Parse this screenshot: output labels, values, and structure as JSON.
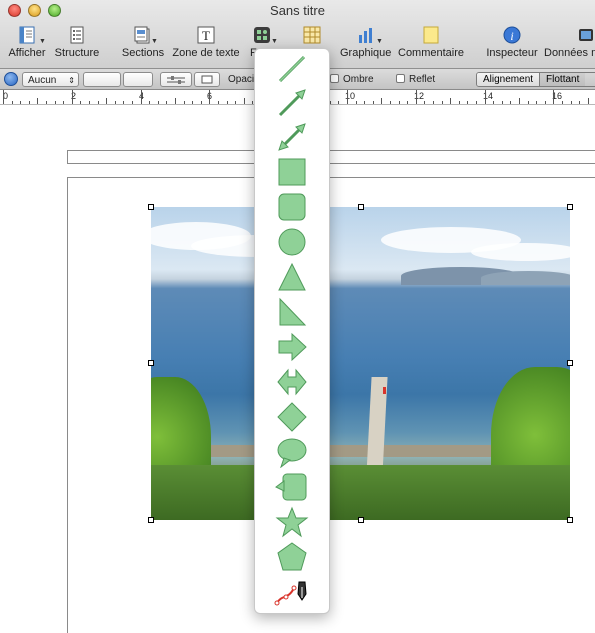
{
  "window": {
    "title": "Sans titre"
  },
  "toolbar": {
    "items": [
      {
        "label": "Afficher",
        "icon": "view-icon"
      },
      {
        "label": "Structure",
        "icon": "outline-icon"
      },
      {
        "label": "Sections",
        "icon": "sections-icon"
      },
      {
        "label": "Zone de texte",
        "icon": "textbox-icon"
      },
      {
        "label": "F",
        "icon": "shapes-icon"
      },
      {
        "label": "",
        "icon": "table-icon"
      },
      {
        "label": "Graphique",
        "icon": "chart-icon"
      },
      {
        "label": "Commentaire",
        "icon": "comment-icon"
      },
      {
        "label": "Inspecteur",
        "icon": "info-icon"
      },
      {
        "label": "Données m",
        "icon": "media-icon"
      }
    ]
  },
  "formatbar": {
    "wrap_value": "Aucun",
    "opacity_label": "Opaci",
    "shadow_label": "Ombre",
    "reflection_label": "Reflet",
    "alignment_label": "Alignement",
    "floating_label": "Flottant"
  },
  "ruler": {
    "numbers": [
      "0",
      "2",
      "4",
      "6",
      "10",
      "12",
      "14",
      "16"
    ]
  },
  "shape_menu": {
    "items": [
      "line-icon",
      "arrow-line-icon",
      "double-arrow-line-icon",
      "square-icon",
      "rounded-square-icon",
      "circle-icon",
      "triangle-icon",
      "right-triangle-icon",
      "arrow-icon",
      "double-arrow-icon",
      "diamond-icon",
      "speech-bubble-icon",
      "callout-icon",
      "star-icon",
      "pentagon-icon",
      "pen-tool-icon"
    ]
  },
  "colors": {
    "shape_fill": "#8fd197",
    "shape_stroke": "#4f9a5a",
    "pen_red": "#d9342b"
  }
}
